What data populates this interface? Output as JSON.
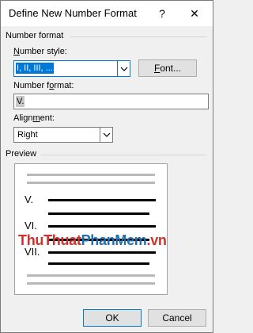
{
  "window": {
    "title": "Define New Number Format",
    "help_glyph": "?",
    "close_glyph": "✕"
  },
  "number_format_group": {
    "heading": "Number format",
    "number_style": {
      "label_pre": "",
      "label_u": "N",
      "label_post": "umber style:",
      "value": "I, II, III, ..."
    },
    "font_button": {
      "label_u": "F",
      "label_post": "ont..."
    },
    "number_format": {
      "label_pre": "Number f",
      "label_u": "o",
      "label_post": "rmat:",
      "value": "V."
    },
    "alignment": {
      "label_pre": "Align",
      "label_u": "m",
      "label_post": "ent:",
      "value": "Right"
    }
  },
  "preview_group": {
    "heading": "Preview",
    "numerals": [
      "V.",
      "VI.",
      "VII."
    ]
  },
  "watermark": {
    "part1": "ThuThuat",
    "part2": "PhanMem",
    "part3": ".vn"
  },
  "footer": {
    "ok_label": "OK",
    "cancel_label": "Cancel"
  },
  "colors": {
    "accent": "#0078d7",
    "watermark_red": "#d0312d",
    "watermark_blue": "#1f6fb5"
  }
}
